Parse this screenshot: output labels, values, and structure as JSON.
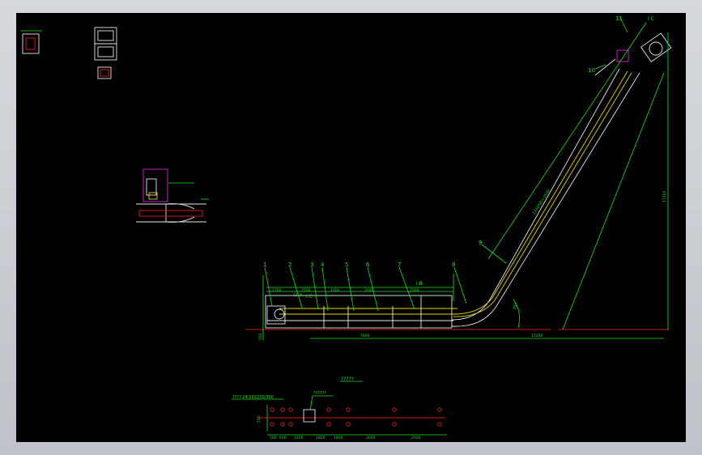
{
  "drawing": {
    "part_labels": [
      "1",
      "2",
      "3",
      "4",
      "5",
      "6",
      "7",
      "8",
      "9",
      "10",
      "11"
    ],
    "section_marks": [
      "I C",
      "I B",
      "I C"
    ],
    "dims_top": [
      "1200",
      "2500",
      "1500",
      "1000",
      "2000",
      "2500"
    ],
    "dim_total_left": "7000",
    "dim_total_right": "15200",
    "dim_vertical": "17200",
    "dim_inclined": "12X2000+2500",
    "angle": "35°",
    "height_left": "550",
    "plan_title": "?????",
    "plan_bolt_note": "???? 14-16X200/300",
    "plan_anchor_note": "??????",
    "plan_dims": [
      "500",
      "600",
      "1200",
      "1800",
      "1800",
      "3000",
      "2500"
    ],
    "plan_side_dim": "550"
  },
  "colors": {
    "background": "#000000",
    "dimension": "#1ee11e",
    "structure": "#e8e8e8",
    "ground": "#d01818",
    "chain": "#e8d200",
    "motor": "#e020e0"
  }
}
